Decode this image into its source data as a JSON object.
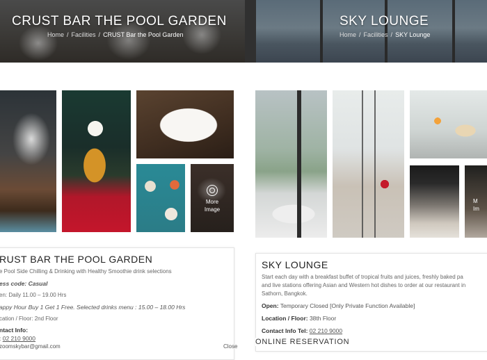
{
  "left_venue": {
    "banner_title": "CRUST BAR THE POOL GARDEN",
    "breadcrumb": {
      "home": "Home",
      "sep": "/",
      "section": "Facilities",
      "current": "CRUST Bar the Pool Garden"
    },
    "more_image_label_1": "More",
    "more_image_label_2": "Image",
    "card": {
      "title": "RUST BAR THE POOL GARDEN",
      "description": "e Pool Side Chilling & Drinking with Healthy Smoothie drink selections",
      "dress_code": "ess code: Casual",
      "open": "en: Daily 11.00 – 19.00 Hrs",
      "happy_hour": "appy Hour Buy 1 Get 1 Free. Selected drinks menu : 15.00 – 18.00 Hrs",
      "location": "cation / Floor: 2nd Floor",
      "contact_label": "ntact Info:",
      "tel_prefix": ": ",
      "tel": "02 210 9000",
      "email": "zoomskybar@gmail.com",
      "close_label": "Close"
    }
  },
  "right_venue": {
    "banner_title": "SKY LOUNGE",
    "breadcrumb": {
      "home": "Home",
      "sep": "/",
      "section": "Facilities",
      "current": "SKY Lounge"
    },
    "more_image_label_1": "M",
    "more_image_label_2": "Im",
    "card": {
      "title": "SKY LOUNGE",
      "desc_line1": "Start each day with a breakfast buffet of tropical fruits and juices, freshly baked pa",
      "desc_line2": "and live stations offering Asian and Western hot dishes to order at our restaurant in",
      "desc_line3": "Sathorn, Bangkok.",
      "open_label": "Open:",
      "open_value": " Temporary Closed [Only Private Function Available]",
      "location_label": "Location / Floor:",
      "location_value": " 38th Floor",
      "contact_label": "Contact Info Tel:",
      "tel": "02 210 9000"
    },
    "online_reservation": "ONLINE RESERVATION"
  }
}
